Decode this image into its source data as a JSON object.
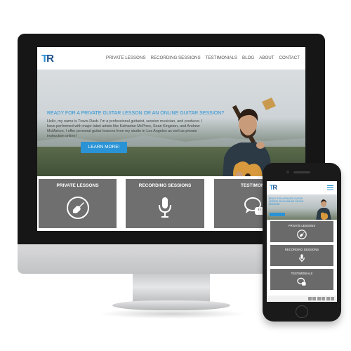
{
  "desktop": {
    "logo": {
      "t": "T",
      "r": "R"
    },
    "nav": [
      "PRIVATE LESSONS",
      "RECORDING SESSIONS",
      "TESTIMONIALS",
      "BLOG",
      "ABOUT",
      "CONTACT"
    ],
    "hero": {
      "heading": "READY FOR A PRIVATE GUITAR LESSON OR AN ONLINE GUITAR SESSION?",
      "body": "Hello, my name is Travis Rasb. I'm a professional guitarist, session musician, and producer. I have performed with major label artists like Katharine McPhee, Sean Kingston, and Andrew McMahon. I offer personal guitar lessons from my studio in Los Angeles as well as private instruction online!",
      "button": "LEARN MORE!"
    },
    "cards": [
      {
        "label": "PRIVATE LESSONS",
        "icon": "guitar-icon"
      },
      {
        "label": "RECORDING SESSIONS",
        "icon": "microphone-icon"
      },
      {
        "label": "TESTIMONI",
        "icon": "chat-quote-icon"
      }
    ]
  },
  "mobile": {
    "logo": {
      "t": "T",
      "r": "R"
    },
    "hero_heading": "READY FOR A PRIVATE GUITAR LESSON OR AN ONLINE GUITAR SESSION?",
    "cards": [
      {
        "label": "PRIVATE LESSONS",
        "icon": "guitar-icon"
      },
      {
        "label": "RECORDING SESSIONS",
        "icon": "microphone-icon"
      },
      {
        "label": "TESTIMONIALS",
        "icon": "chat-quote-icon"
      }
    ]
  },
  "colors": {
    "accent": "#2a93d5",
    "logo_dark": "#1a4f8a",
    "card_bg": "#6f6f6f"
  }
}
